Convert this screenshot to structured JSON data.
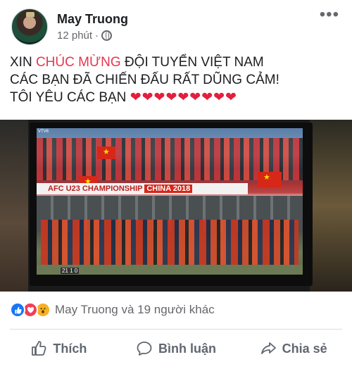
{
  "post": {
    "author": "May Truong",
    "time": "12 phút",
    "separator": "·",
    "more": "•••",
    "text_lines": {
      "line1_before": "XIN ",
      "line1_highlight": "CHÚC MỪNG",
      "line1_after": " ĐỘI TUYỂN VIỆT NAM",
      "line2": "CÁC BẠN ĐÃ CHIẾN ĐẤU RẤT DŨNG CẢM!",
      "line3": "TÔI YÊU CÁC BẠN ",
      "hearts": "❤❤❤❤❤❤❤❤❤"
    },
    "colors": {
      "highlight": "#e4364f",
      "heart": "#e41e3f",
      "like_blue": "#1877f2",
      "love_red": "#f33e58",
      "wow_yellow": "#f7b125"
    }
  },
  "media": {
    "banner_text": "AFC U23 CHAMPIONSHIP",
    "banner_host": "CHINA 2018",
    "channel": "VTV6",
    "score_text": "21 1 0"
  },
  "reactions": {
    "icons": [
      "like-icon",
      "love-icon",
      "wow-icon"
    ],
    "summary": "May Truong và 19 người khác"
  },
  "actions": {
    "like": "Thích",
    "comment": "Bình luận",
    "share": "Chia sẻ"
  }
}
